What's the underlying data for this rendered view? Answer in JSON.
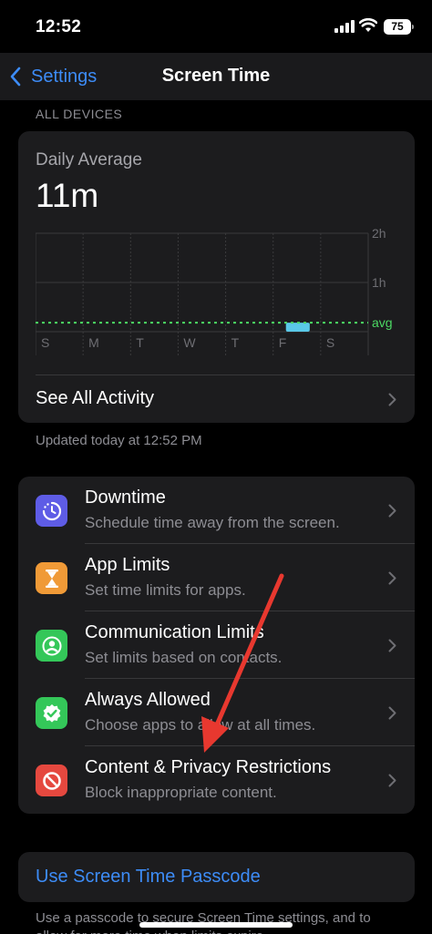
{
  "status_bar": {
    "time": "12:52",
    "battery": "75"
  },
  "nav": {
    "back_label": "Settings",
    "title": "Screen Time"
  },
  "section_header": "ALL DEVICES",
  "activity": {
    "daily_label": "Daily Average",
    "daily_value": "11m",
    "see_all_label": "See All Activity",
    "updated_note": "Updated today at 12:52 PM"
  },
  "chart_data": {
    "type": "bar",
    "categories": [
      "S",
      "M",
      "T",
      "W",
      "T",
      "F",
      "S"
    ],
    "values": [
      0,
      0,
      0,
      0,
      0,
      11,
      0
    ],
    "y_tick_labels": [
      "2h",
      "1h"
    ],
    "ylim_minutes": [
      0,
      120
    ],
    "average_label": "avg",
    "average_minutes": 11,
    "bar_color": "#5ac8e8",
    "avg_color": "#4cd964",
    "grid": true
  },
  "settings": [
    {
      "title": "Downtime",
      "subtitle": "Schedule time away from the screen.",
      "icon": "downtime-icon",
      "color": "#5e5ce6"
    },
    {
      "title": "App Limits",
      "subtitle": "Set time limits for apps.",
      "icon": "hourglass-icon",
      "color": "#f09a37"
    },
    {
      "title": "Communication Limits",
      "subtitle": "Set limits based on contacts.",
      "icon": "person-circle-icon",
      "color": "#34c759"
    },
    {
      "title": "Always Allowed",
      "subtitle": "Choose apps to allow at all times.",
      "icon": "checkmark-badge-icon",
      "color": "#34c759"
    },
    {
      "title": "Content & Privacy Restrictions",
      "subtitle": "Block inappropriate content.",
      "icon": "restriction-icon",
      "color": "#e5483f"
    }
  ],
  "passcode": {
    "label": "Use Screen Time Passcode",
    "footer": "Use a passcode to secure Screen Time settings, and to allow for more time when limits expire."
  },
  "colors": {
    "accent": "#3d8cf7",
    "annotation_arrow": "#e8382f"
  }
}
